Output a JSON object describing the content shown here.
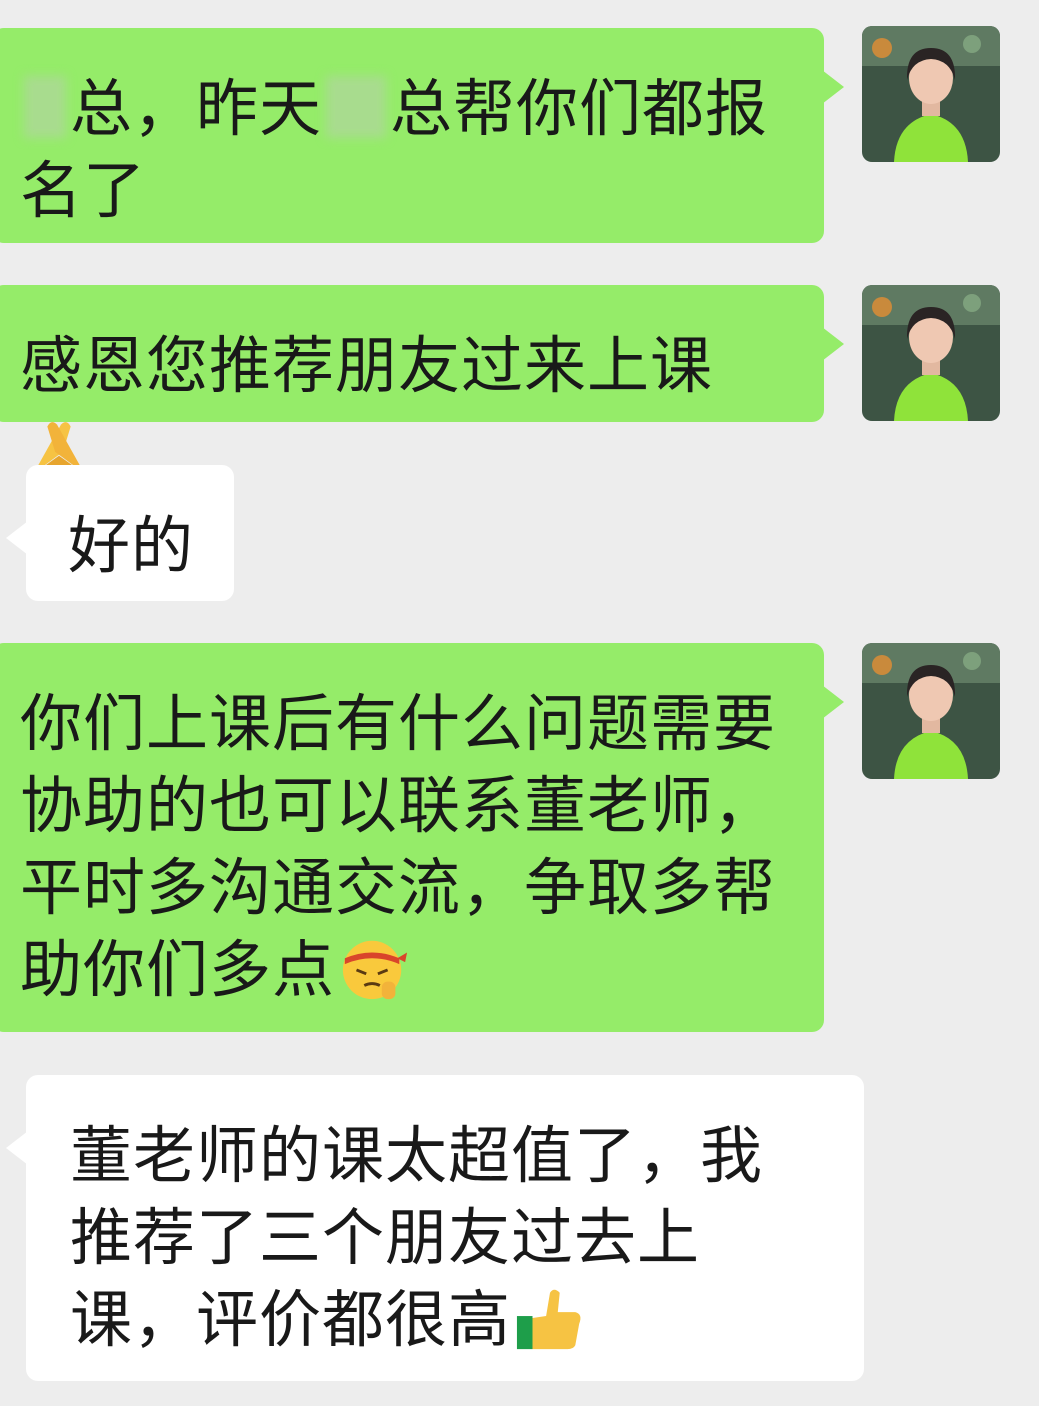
{
  "chat": {
    "messages": [
      {
        "sender": "me",
        "before": "",
        "mid": "总，昨天",
        "after": "总帮你们都报名了"
      },
      {
        "sender": "me",
        "text": "感恩您推荐朋友过来上课",
        "emoji": "folded-hands-icon"
      },
      {
        "sender": "other",
        "text": "好的"
      },
      {
        "sender": "me",
        "text": "你们上课后有什么问题需要协助的也可以联系董老师，平时多沟通交流，争取多帮助你们多点",
        "emoji": "headband-face-icon"
      },
      {
        "sender": "other",
        "text": "董老师的课太超值了，我推荐了三个朋友过去上课，评价都很高",
        "emoji": "thumbs-up-icon"
      }
    ]
  },
  "colors": {
    "background": "#ededed",
    "sent_bubble": "#95ec69",
    "received_bubble": "#ffffff",
    "text": "#191919"
  }
}
